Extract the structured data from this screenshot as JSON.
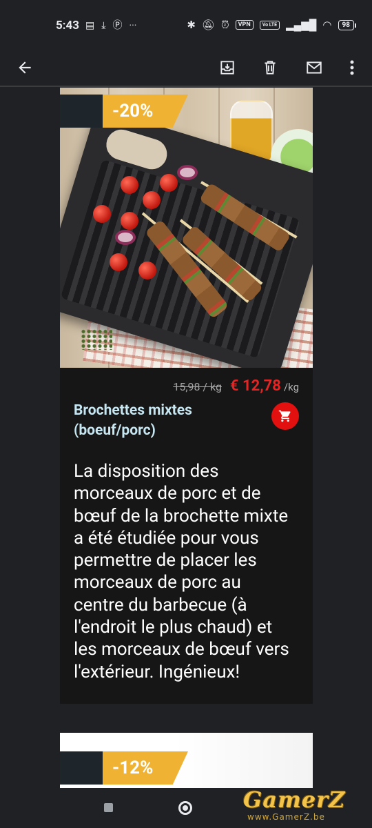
{
  "status_bar": {
    "time": "5:43",
    "vpn": "VPN",
    "volte": "Vo LTE",
    "battery": "98"
  },
  "app_bar": {
    "icons": [
      "back-arrow-icon",
      "archive-icon",
      "trash-icon",
      "mail-icon",
      "more-vert-icon"
    ]
  },
  "product": {
    "discount": "-20%",
    "old_price": "15,98 / kg",
    "new_price": "€ 12,78",
    "unit": "/kg",
    "title_line1": "Brochettes mixtes",
    "title_line2": "(boeuf/porc)",
    "description_lines": [
      "La disposition des",
      "morceaux de porc et de",
      "bœuf de la brochette mixte",
      "a été étudiée pour vous",
      "permettre de placer les",
      "morceaux de porc au",
      "centre du barbecue (à",
      "l'endroit le plus chaud) et",
      "les morceaux de bœuf vers",
      "l'extérieur. Ingénieux!"
    ]
  },
  "next_product": {
    "discount": "-12%"
  },
  "watermark": {
    "name": "GamerZ",
    "url": "www.GamerZ.be"
  },
  "colors": {
    "badge_gold": "#f0b232",
    "price_red": "#e52424",
    "cart_red": "#e31010",
    "title_blue": "#c6e6f2"
  }
}
